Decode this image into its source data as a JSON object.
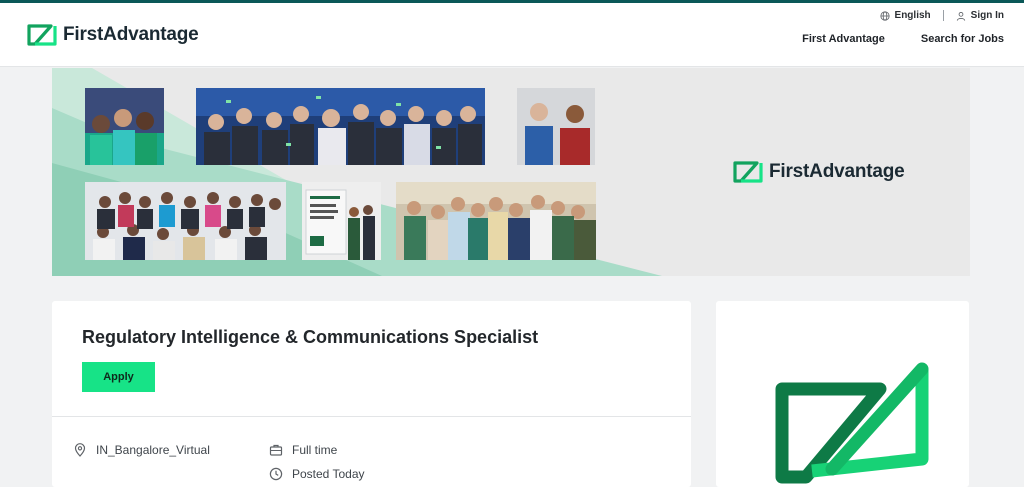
{
  "header": {
    "logo_text": "FirstAdvantage",
    "language_label": "English",
    "signin_label": "Sign In",
    "nav": [
      "First Advantage",
      "Search for Jobs"
    ]
  },
  "banner": {
    "logo_text": "FirstAdvantage"
  },
  "job": {
    "title": "Regulatory Intelligence & Communications Specialist",
    "apply_label": "Apply",
    "location": "IN_Bangalore_Virtual",
    "employment_type": "Full time",
    "posted": "Posted Today"
  },
  "colors": {
    "brand_green": "#17e387",
    "logo_dark_green": "#0e7a46",
    "top_border": "#0b5858",
    "banner_mint": "#a9dcc8"
  },
  "icons": [
    "globe-icon",
    "user-icon",
    "location-pin-icon",
    "briefcase-icon",
    "clock-icon"
  ]
}
